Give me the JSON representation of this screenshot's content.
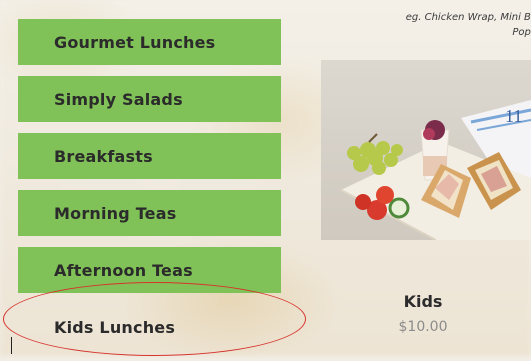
{
  "menu": {
    "items": [
      {
        "label": "Gourmet Lunches"
      },
      {
        "label": "Simply Salads"
      },
      {
        "label": "Breakfasts"
      },
      {
        "label": "Morning Teas"
      },
      {
        "label": "Afternoon Teas"
      },
      {
        "label": "Kids Lunches"
      }
    ]
  },
  "product": {
    "hint_line1": "eg. Chicken Wrap, Mini Bo",
    "hint_line2": "Pope",
    "name": "Kids",
    "price": "$10.00",
    "image_icon": "lunch-platter-image"
  },
  "colors": {
    "menu_green": "#80c257",
    "highlight_red": "#d6332c"
  }
}
